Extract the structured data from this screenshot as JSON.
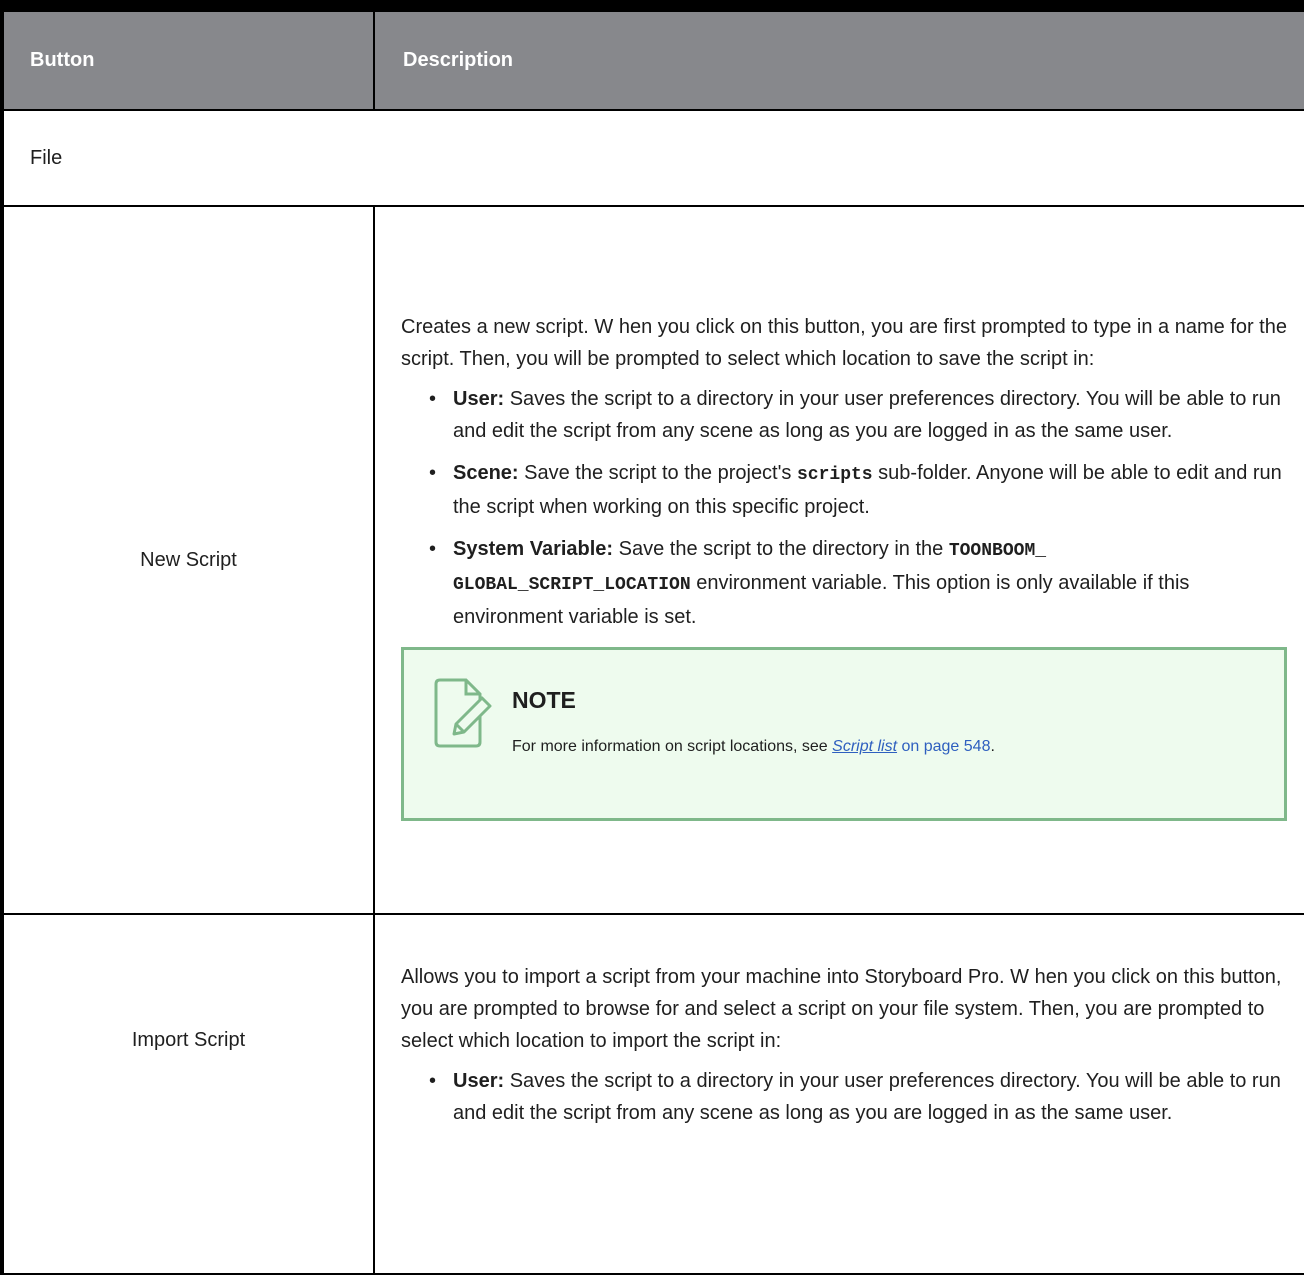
{
  "table": {
    "headers": {
      "button": "Button",
      "description": "Description"
    },
    "section": "File",
    "rows": {
      "new_script": {
        "button": "New Script",
        "intro": "Creates a new script. W hen you click on this button, you are first prompted to type in a name for the script. Then, you will be prompted to select which location to save the script in:",
        "bullets": [
          {
            "term": "User:",
            "text": " Saves the script to a directory in your user preferences directory. You will be able to run and edit the script from any scene as long as you are logged in as the same user."
          },
          {
            "term": "Scene:",
            "text_before": " Save the script to the project's ",
            "code": "scripts",
            "text_after": " sub-folder. Anyone will be able to edit and run the script when working on this specific project."
          },
          {
            "term": "System Variable:",
            "text_before": " Save the script to the directory in the ",
            "code_line1": "TOONBOOM_",
            "code_line2": "GLOBAL_SCRIPT_LOCATION",
            "text_after": " environment variable. This option is only available if this environment variable is set."
          }
        ],
        "note": {
          "title": "NOTE",
          "text_before": "For more information on script locations, see ",
          "link": "Script list",
          "page_ref": " on page 548",
          "text_after": "."
        }
      },
      "import_script": {
        "button": "Import Script",
        "intro": "Allows you to import a script from your machine into Storyboard Pro. W hen you click on this button, you are prompted to browse for and select a script on your file system. Then, you are prompted to select which location to import the script in:",
        "bullets": [
          {
            "term": "User:",
            "text": " Saves the script to a directory in your user preferences directory. You will be able to run and edit the script from any scene as long as you are logged in as the same user."
          }
        ]
      }
    }
  },
  "colors": {
    "header_bg": "#87888c",
    "note_bg": "#eefbee",
    "note_border": "#7fb88a",
    "link": "#2e5fbf"
  },
  "icons": {
    "note": "note-edit-icon"
  }
}
